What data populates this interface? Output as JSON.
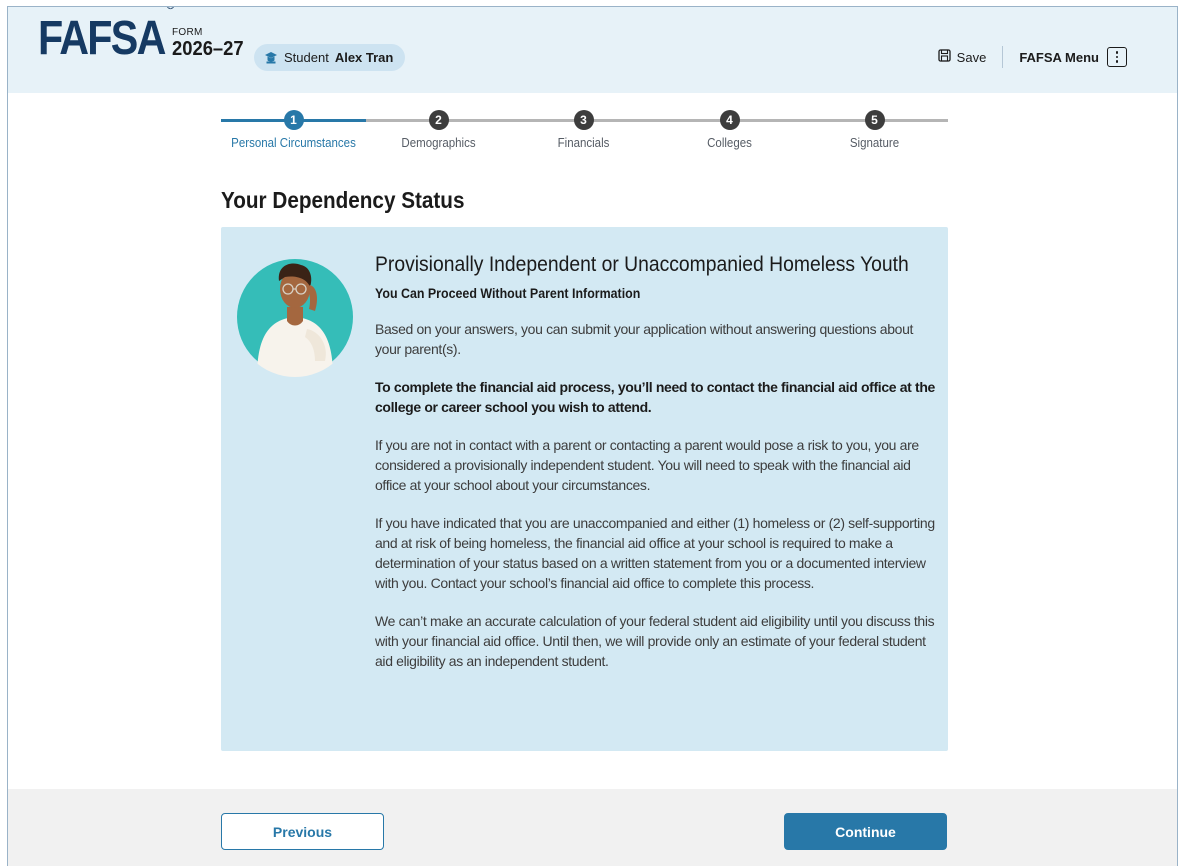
{
  "header": {
    "logo": "FAFSA",
    "logo_mark": "®",
    "form_label": "FORM",
    "form_year": "2026–27",
    "student_prefix": "Student",
    "student_name": "Alex Tran",
    "save_label": "Save",
    "menu_label": "FAFSA Menu"
  },
  "stepper": {
    "steps": [
      {
        "number": "1",
        "label": "Personal Circumstances",
        "active": true
      },
      {
        "number": "2",
        "label": "Demographics",
        "active": false
      },
      {
        "number": "3",
        "label": "Financials",
        "active": false
      },
      {
        "number": "4",
        "label": "Colleges",
        "active": false
      },
      {
        "number": "5",
        "label": "Signature",
        "active": false
      }
    ]
  },
  "page": {
    "title": "Your Dependency Status"
  },
  "card": {
    "title": "Provisionally Independent or Unaccompanied Homeless Youth",
    "subtitle": "You Can Proceed Without Parent Information",
    "p1": "Based on your answers, you can submit your application without answering questions about your parent(s).",
    "p2": "To complete the financial aid process, you’ll need to contact the financial aid office at the college or career school you wish to attend.",
    "p3": "If you are not in contact with a parent or contacting a parent would pose a risk to you, you are considered a provisionally independent student. You will need to speak with the financial aid office at your school about your circumstances.",
    "p4": "If you have indicated that you are unaccompanied and either (1) homeless or (2) self-supporting and at risk of being homeless, the financial aid office at your school is required to make a determination of your status based on a written statement from you or a documented interview with you. Contact your school’s financial aid office to complete this process.",
    "p5": "We can’t make an accurate calculation of your federal student aid eligibility until you discuss this with your financial aid office. Until then, we will provide only an estimate of your federal student aid eligibility as an independent student."
  },
  "footer": {
    "previous_label": "Previous",
    "continue_label": "Continue"
  },
  "colors": {
    "brand_navy": "#163a63",
    "accent_blue": "#2878a8",
    "card_bg": "#d3e9f3",
    "header_bg": "#e7f2f8",
    "avatar_teal": "#35bdb8"
  },
  "icons": {
    "student": "student-cap-icon",
    "save": "save-disk-icon",
    "menu": "kebab-menu-icon"
  }
}
